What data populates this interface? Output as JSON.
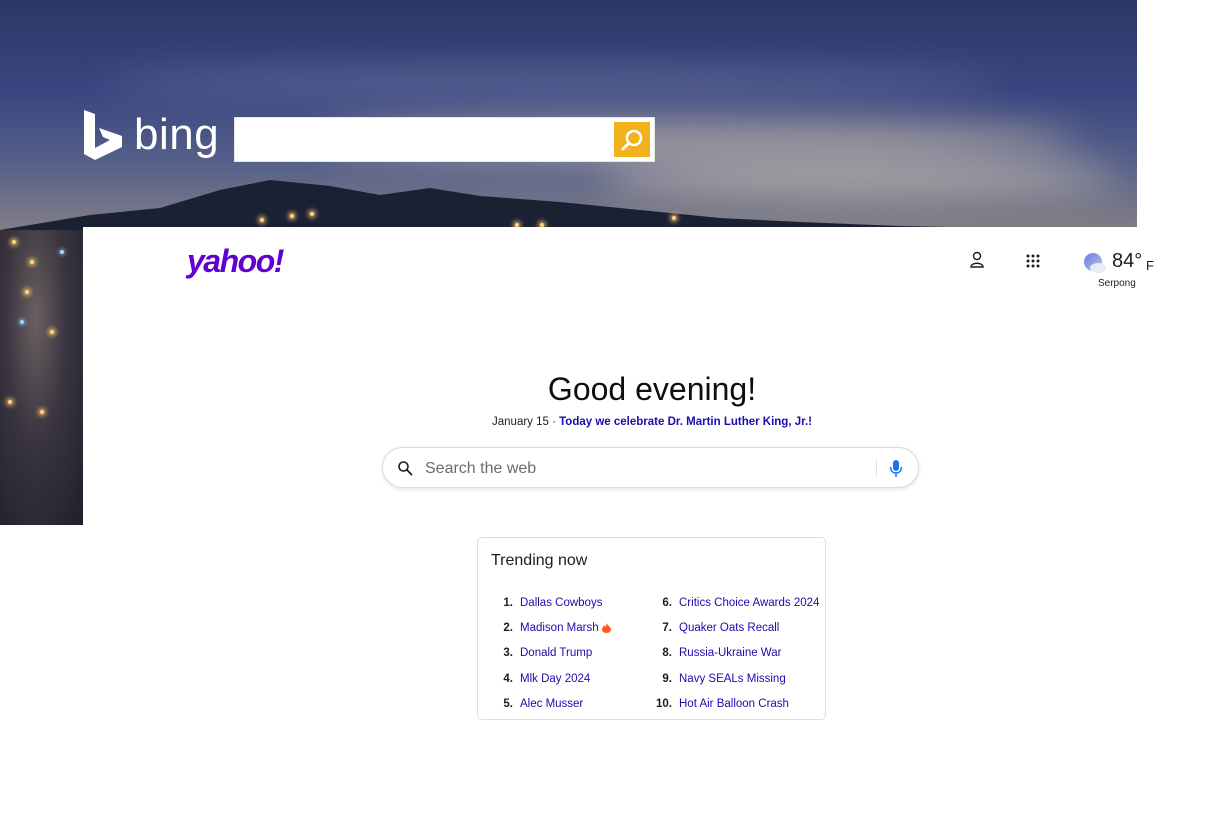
{
  "bing": {
    "brand": "bing",
    "search_value": "",
    "accent_color": "#f2b21c"
  },
  "yahoo": {
    "logo_text": "yahoo!",
    "brand_color": "#6001d2",
    "weather": {
      "temp": "84°",
      "unit": "F",
      "location": "Serpong",
      "icon": "moon-cloud-icon"
    },
    "greeting": "Good evening!",
    "date": "January 15 · ",
    "holiday_link": "Today we celebrate Dr. Martin Luther King, Jr.!",
    "search": {
      "placeholder": "Search the web",
      "value": ""
    },
    "trending": {
      "title": "Trending now",
      "items": [
        {
          "rank": "1.",
          "term": "Dallas Cowboys",
          "hot": false
        },
        {
          "rank": "2.",
          "term": "Madison Marsh",
          "hot": true
        },
        {
          "rank": "3.",
          "term": "Donald Trump",
          "hot": false
        },
        {
          "rank": "4.",
          "term": "Mlk Day 2024",
          "hot": false
        },
        {
          "rank": "5.",
          "term": "Alec Musser",
          "hot": false
        },
        {
          "rank": "6.",
          "term": "Critics Choice Awards 2024",
          "hot": false
        },
        {
          "rank": "7.",
          "term": "Quaker Oats Recall",
          "hot": false
        },
        {
          "rank": "8.",
          "term": "Russia-Ukraine War",
          "hot": false
        },
        {
          "rank": "9.",
          "term": "Navy SEALs Missing",
          "hot": false
        },
        {
          "rank": "10.",
          "term": "Hot Air Balloon Crash",
          "hot": false
        }
      ]
    }
  }
}
